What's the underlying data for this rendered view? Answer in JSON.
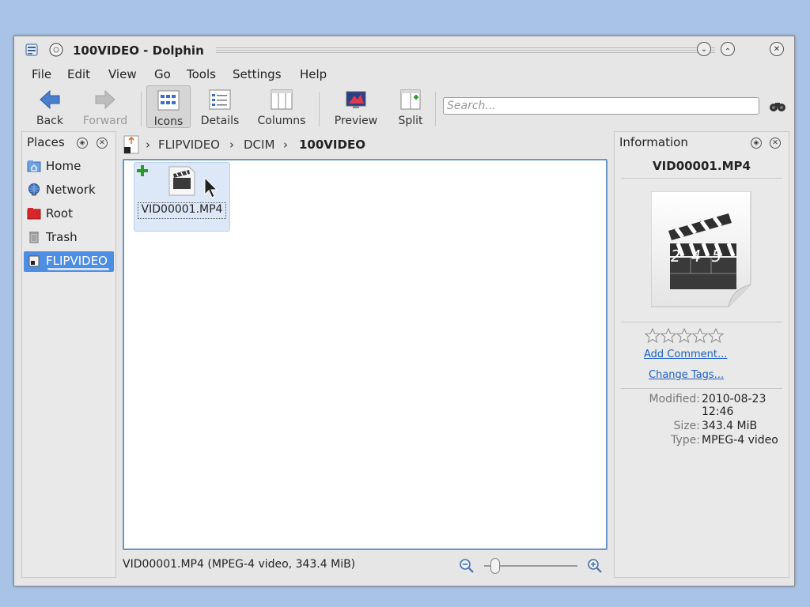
{
  "window": {
    "title": "100VIDEO - Dolphin"
  },
  "menu": [
    "File",
    "Edit",
    "View",
    "Go",
    "Tools",
    "Settings",
    "Help"
  ],
  "toolbar": {
    "back": "Back",
    "forward": "Forward",
    "icons": "Icons",
    "details": "Details",
    "columns": "Columns",
    "preview": "Preview",
    "split": "Split",
    "search_placeholder": "Search..."
  },
  "places": {
    "title": "Places",
    "items": [
      {
        "label": "Home",
        "icon": "home-folder-icon"
      },
      {
        "label": "Network",
        "icon": "network-icon"
      },
      {
        "label": "Root",
        "icon": "root-folder-icon"
      },
      {
        "label": "Trash",
        "icon": "trash-icon"
      },
      {
        "label": "FLIPVIDEO",
        "icon": "usb-drive-icon",
        "selected": true
      }
    ]
  },
  "breadcrumb": {
    "items": [
      "FLIPVIDEO",
      "DCIM",
      "100VIDEO"
    ]
  },
  "files": [
    {
      "name": "VID00001.MP4",
      "icon": "video-file-icon",
      "selected": true
    }
  ],
  "status": {
    "text": "VID00001.MP4 (MPEG-4 video, 343.4 MiB)",
    "zoom_level": 0.12
  },
  "info": {
    "title": "Information",
    "filename": "VID00001.MP4",
    "rating": 0,
    "rating_max": 5,
    "add_comment": "Add Comment...",
    "change_tags": "Change Tags...",
    "modified_label": "Modified:",
    "modified_date": "2010-08-23",
    "modified_time": "12:46",
    "size_label": "Size:",
    "size_value": "343.4 MiB",
    "type_label": "Type:",
    "type_value": "MPEG-4 video",
    "preview_digits": [
      "2",
      "4",
      "5"
    ]
  },
  "colors": {
    "selection": "#4d8ee3",
    "link": "#1e5fbf",
    "view_border": "#6a95c9"
  }
}
